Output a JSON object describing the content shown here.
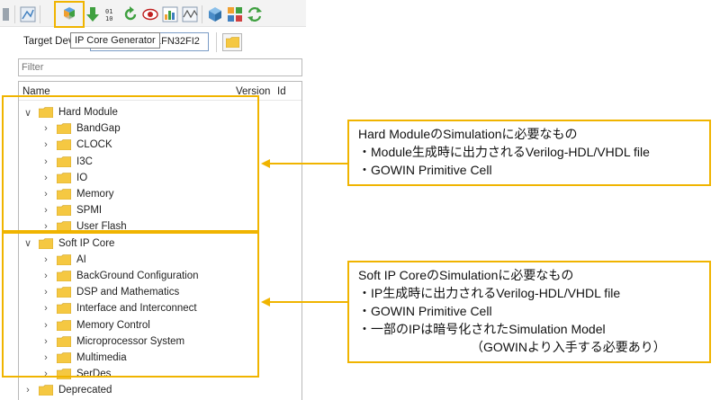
{
  "toolbar": {
    "icons": [
      "panel-icon",
      "grid-icon",
      "ip-core-generator-icon",
      "download-icon",
      "binary-icon",
      "refresh-icon",
      "eye-icon",
      "chart-icon",
      "wave-icon",
      "cube-icon",
      "blocks-icon",
      "sync-icon"
    ],
    "tooltip": "IP Core Generator"
  },
  "target_device": {
    "label": "Target Dev",
    "value": "1FN32FI2"
  },
  "filter": {
    "placeholder": "Filter"
  },
  "tree": {
    "columns": [
      "Name",
      "Version",
      "Id"
    ],
    "groups": [
      {
        "label": "Hard Module",
        "expanded": true,
        "children": [
          "BandGap",
          "CLOCK",
          "I3C",
          "IO",
          "Memory",
          "SPMI",
          "User Flash"
        ]
      },
      {
        "label": "Soft IP Core",
        "expanded": true,
        "children": [
          "AI",
          "BackGround Configuration",
          "DSP and Mathematics",
          "Interface and Interconnect",
          "Memory Control",
          "Microprocessor System",
          "Multimedia",
          "SerDes"
        ]
      },
      {
        "label": "Deprecated",
        "expanded": false,
        "children": []
      }
    ]
  },
  "callouts": {
    "hard": [
      "Hard ModuleのSimulationに必要なもの",
      "・Module生成時に出力されるVerilog-HDL/VHDL file",
      "・GOWIN Primitive Cell"
    ],
    "soft": [
      "Soft IP CoreのSimulationに必要なもの",
      "・IP生成時に出力されるVerilog-HDL/VHDL file",
      "・GOWIN Primitive Cell",
      "・一部のIPは暗号化されたSimulation Model",
      "（GOWINより入手する必要あり）"
    ]
  },
  "colors": {
    "accent": "#f0b400",
    "folder": "#f5c842",
    "selection": "#7a9cc6"
  }
}
